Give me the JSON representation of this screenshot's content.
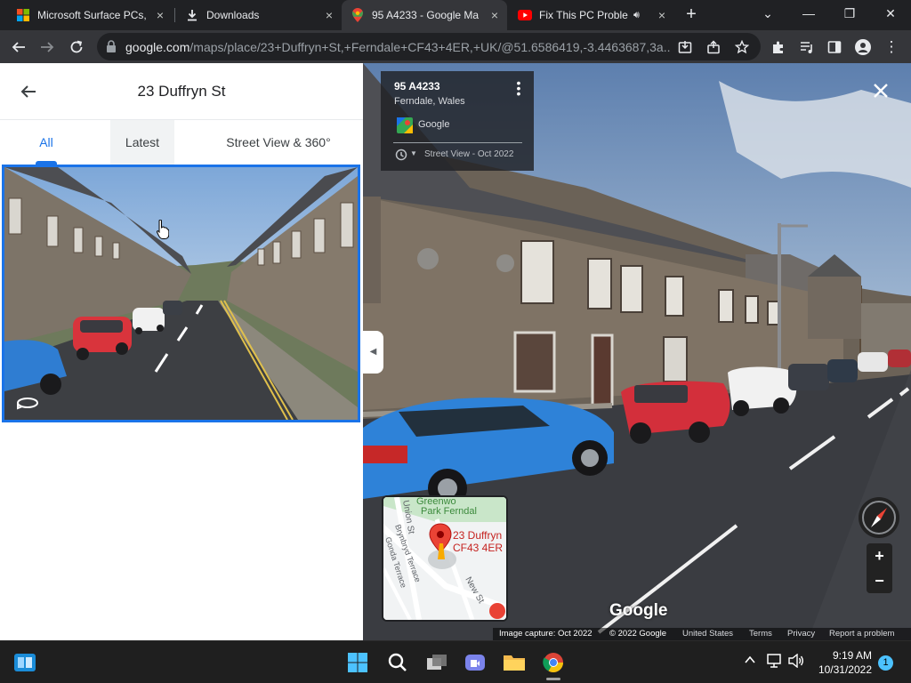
{
  "tabs": [
    {
      "title": "Microsoft Surface PCs, ",
      "favicon": "microsoft-logo-icon",
      "close": "×"
    },
    {
      "title": "Downloads",
      "favicon": "download-icon",
      "close": "×"
    },
    {
      "title": "95 A4233 - Google Ma",
      "favicon": "google-maps-icon",
      "close": "×",
      "active": true
    },
    {
      "title": "Fix This PC Problem",
      "favicon": "youtube-icon",
      "close": "×"
    }
  ],
  "window_controls": {
    "dropdown": "⌄",
    "minimize": "—",
    "restore": "❐",
    "close": "✕"
  },
  "omnibox": {
    "host": "google.com",
    "path": "/maps/place/23+Duffryn+St,+Ferndale+CF43+4ER,+UK/@51.6586419,-3.4463687,3a..."
  },
  "left_panel": {
    "title": "23 Duffryn St",
    "tabs": [
      "All",
      "Latest",
      "Street View & 360°"
    ],
    "selected_tab": "All"
  },
  "street_view": {
    "road": "95 A4233",
    "place": "Ferndale, Wales",
    "provider": "Google",
    "date": "Street View - Oct 2022",
    "watermark": "Google",
    "zoom_in": "+",
    "zoom_out": "−",
    "collapse": "◀",
    "footer": {
      "capture": "Image capture: Oct 2022",
      "copyright": "© 2022 Google",
      "country": "United States",
      "terms": "Terms",
      "privacy": "Privacy",
      "report": "Report a problem"
    },
    "minimap": {
      "labels": [
        "Greenwo",
        "Park Ferndal",
        "23 Duffryn",
        "CF43 4ER",
        "Union St",
        "Brynbryd Terrace",
        "Gonda Terrace",
        "New St"
      ]
    }
  },
  "taskbar": {
    "time": "9:19 AM",
    "date": "10/31/2022",
    "badge": "1"
  },
  "colors": {
    "accent": "#1a73e8",
    "maps_red": "#ea4335",
    "tab_bg": "#35363a",
    "chrome_bg": "#202124"
  }
}
